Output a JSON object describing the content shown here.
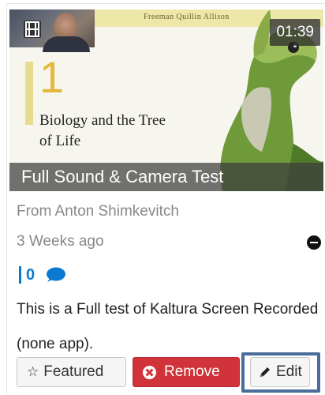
{
  "video": {
    "duration": "01:39",
    "title": "Full Sound & Camera Test",
    "thumbnail": {
      "authors": "Freeman  Quillin  Allison",
      "chapter_number": "1",
      "chapter_title": "Biology and the Tree of Life"
    }
  },
  "meta": {
    "from": "From Anton Shimkevitch",
    "posted": "3 Weeks ago"
  },
  "stats": {
    "comments": "0"
  },
  "description": "This is a Full test of Kaltura Screen Recorded (none app).",
  "actions": {
    "featured_label": "Featured",
    "remove_label": "Remove",
    "edit_label": "Edit"
  },
  "icons": {
    "media_type": "film-icon",
    "remove_circle": "minus-circle-icon",
    "comments": "speech-bubble-icon",
    "featured": "star-outline-icon",
    "remove": "x-circle-icon",
    "edit": "pencil-icon"
  },
  "colors": {
    "accent_blue": "#0a7ad1",
    "danger_red": "#d0343a",
    "focus_border": "#4a6e99"
  }
}
